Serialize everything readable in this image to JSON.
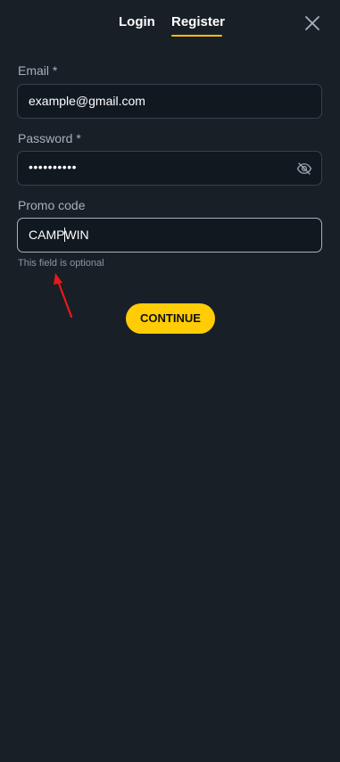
{
  "tabs": [
    {
      "label": "Login",
      "active": false
    },
    {
      "label": "Register",
      "active": true
    }
  ],
  "icons": {
    "close": "close-icon",
    "eye": "eye-slash-icon"
  },
  "form": {
    "email": {
      "label": "Email *",
      "value": "example@gmail.com"
    },
    "password": {
      "label": "Password *",
      "value_masked": "••••••••••"
    },
    "promo": {
      "label": "Promo code",
      "value_before_caret": "CAMP",
      "value_after_caret": "WIN",
      "hint": "This field is optional"
    }
  },
  "continue_label": "CONTINUE",
  "colors": {
    "background": "#181f26",
    "accent": "#ffcc05",
    "annotation_arrow": "#e31b1b"
  }
}
